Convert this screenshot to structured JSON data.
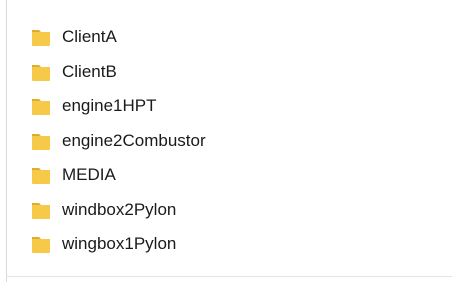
{
  "folders": [
    {
      "name": "ClientA",
      "icon": "folder-icon"
    },
    {
      "name": "ClientB",
      "icon": "folder-icon"
    },
    {
      "name": "engine1HPT",
      "icon": "folder-icon"
    },
    {
      "name": "engine2Combustor",
      "icon": "folder-icon"
    },
    {
      "name": "MEDIA",
      "icon": "folder-icon"
    },
    {
      "name": "windbox2Pylon",
      "icon": "folder-icon"
    },
    {
      "name": "wingbox1Pylon",
      "icon": "folder-icon"
    }
  ],
  "colors": {
    "folder_body": "#f7c948",
    "folder_tab": "#e0ac2a"
  }
}
